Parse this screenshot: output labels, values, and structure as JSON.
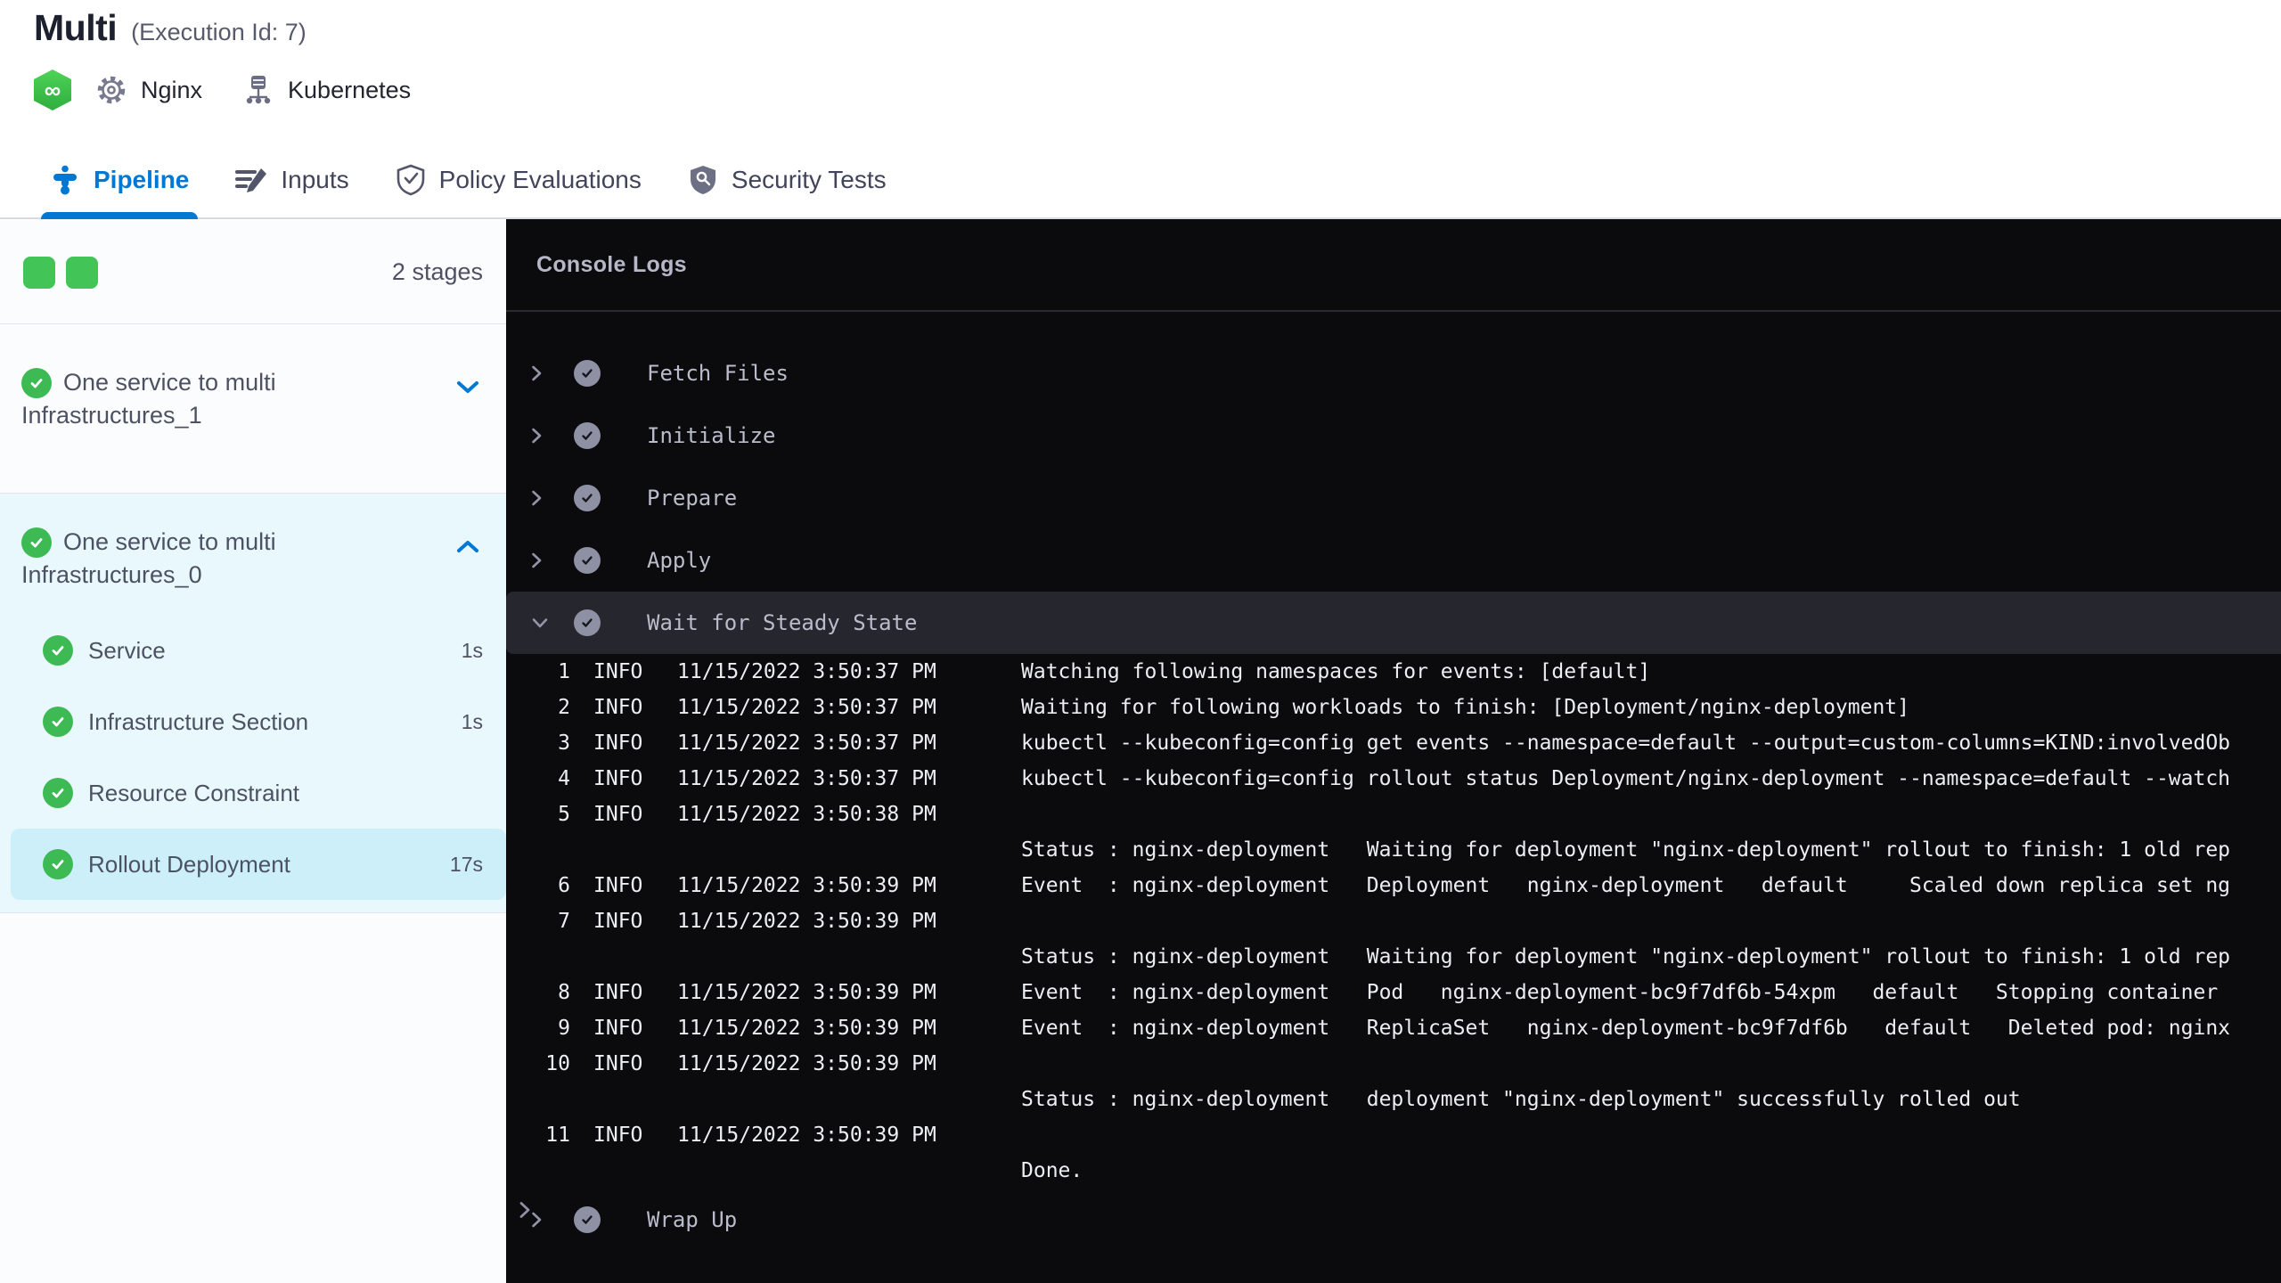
{
  "header": {
    "title": "Multi",
    "subtitle": "(Execution Id: 7)",
    "service": {
      "label": "Nginx"
    },
    "environment": {
      "label": "Kubernetes"
    }
  },
  "tabs": [
    {
      "label": "Pipeline",
      "active": true
    },
    {
      "label": "Inputs",
      "active": false
    },
    {
      "label": "Policy Evaluations",
      "active": false
    },
    {
      "label": "Security Tests",
      "active": false
    }
  ],
  "sidebar": {
    "stage_count": "2 stages",
    "stages": [
      {
        "name": "One service to multi Infrastructures_1",
        "expanded": false
      },
      {
        "name": "One service to multi Infrastructures_0",
        "expanded": true,
        "steps": [
          {
            "name": "Service",
            "duration": "1s",
            "selected": false
          },
          {
            "name": "Infrastructure Section",
            "duration": "1s",
            "selected": false
          },
          {
            "name": "Resource Constraint",
            "duration": "",
            "selected": false
          },
          {
            "name": "Rollout Deployment",
            "duration": "17s",
            "selected": true
          }
        ]
      }
    ]
  },
  "console": {
    "title": "Console Logs",
    "sections": [
      "Fetch Files",
      "Initialize",
      "Prepare",
      "Apply",
      "Wait for Steady State",
      "Wrap Up"
    ],
    "log_rows": [
      {
        "num": "1",
        "level": "INFO",
        "time": "11/15/2022 3:50:37 PM",
        "msg": "Watching following namespaces for events: [default]"
      },
      {
        "num": "2",
        "level": "INFO",
        "time": "11/15/2022 3:50:37 PM",
        "msg": "Waiting for following workloads to finish: [Deployment/nginx-deployment]"
      },
      {
        "num": "3",
        "level": "INFO",
        "time": "11/15/2022 3:50:37 PM",
        "msg": "kubectl --kubeconfig=config get events --namespace=default --output=custom-columns=KIND:involvedOb"
      },
      {
        "num": "4",
        "level": "INFO",
        "time": "11/15/2022 3:50:37 PM",
        "msg": "kubectl --kubeconfig=config rollout status Deployment/nginx-deployment --namespace=default --watch"
      },
      {
        "num": "5",
        "level": "INFO",
        "time": "11/15/2022 3:50:38 PM",
        "msg": ""
      },
      {
        "num": "",
        "level": "",
        "time": "",
        "msg": "Status : nginx-deployment   Waiting for deployment \"nginx-deployment\" rollout to finish: 1 old rep"
      },
      {
        "num": "6",
        "level": "INFO",
        "time": "11/15/2022 3:50:39 PM",
        "msg": "Event  : nginx-deployment   Deployment   nginx-deployment   default     Scaled down replica set ng"
      },
      {
        "num": "7",
        "level": "INFO",
        "time": "11/15/2022 3:50:39 PM",
        "msg": ""
      },
      {
        "num": "",
        "level": "",
        "time": "",
        "msg": "Status : nginx-deployment   Waiting for deployment \"nginx-deployment\" rollout to finish: 1 old rep"
      },
      {
        "num": "8",
        "level": "INFO",
        "time": "11/15/2022 3:50:39 PM",
        "msg": "Event  : nginx-deployment   Pod   nginx-deployment-bc9f7df6b-54xpm   default   Stopping container "
      },
      {
        "num": "9",
        "level": "INFO",
        "time": "11/15/2022 3:50:39 PM",
        "msg": "Event  : nginx-deployment   ReplicaSet   nginx-deployment-bc9f7df6b   default   Deleted pod: nginx"
      },
      {
        "num": "10",
        "level": "INFO",
        "time": "11/15/2022 3:50:39 PM",
        "msg": ""
      },
      {
        "num": "",
        "level": "",
        "time": "",
        "msg": "Status : nginx-deployment   deployment \"nginx-deployment\" successfully rolled out"
      },
      {
        "num": "11",
        "level": "INFO",
        "time": "11/15/2022 3:50:39 PM",
        "msg": ""
      },
      {
        "num": "",
        "level": "",
        "time": "",
        "msg": "Done."
      }
    ]
  },
  "colors": {
    "accent_blue": "#0278d5",
    "success_green": "#3eba55",
    "stage_square_green": "#42c556",
    "stage_expanded_bg": "#e8f8fd",
    "selected_step_bg": "#cdeff9",
    "console_bg": "#0b0b0e",
    "console_highlight_row": "#25262e"
  }
}
